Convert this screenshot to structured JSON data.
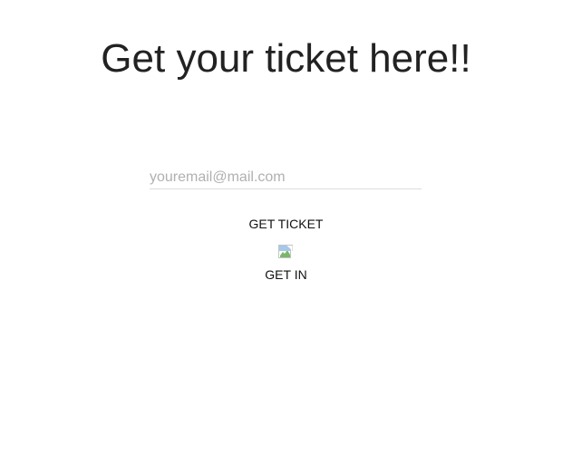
{
  "heading": {
    "title": "Get your ticket here!!"
  },
  "form": {
    "email_placeholder": "youremail@mail.com",
    "email_value": "",
    "get_ticket_label": "GET TICKET",
    "get_in_label": "GET IN"
  },
  "icons": {
    "broken_image": "broken-image-icon"
  }
}
